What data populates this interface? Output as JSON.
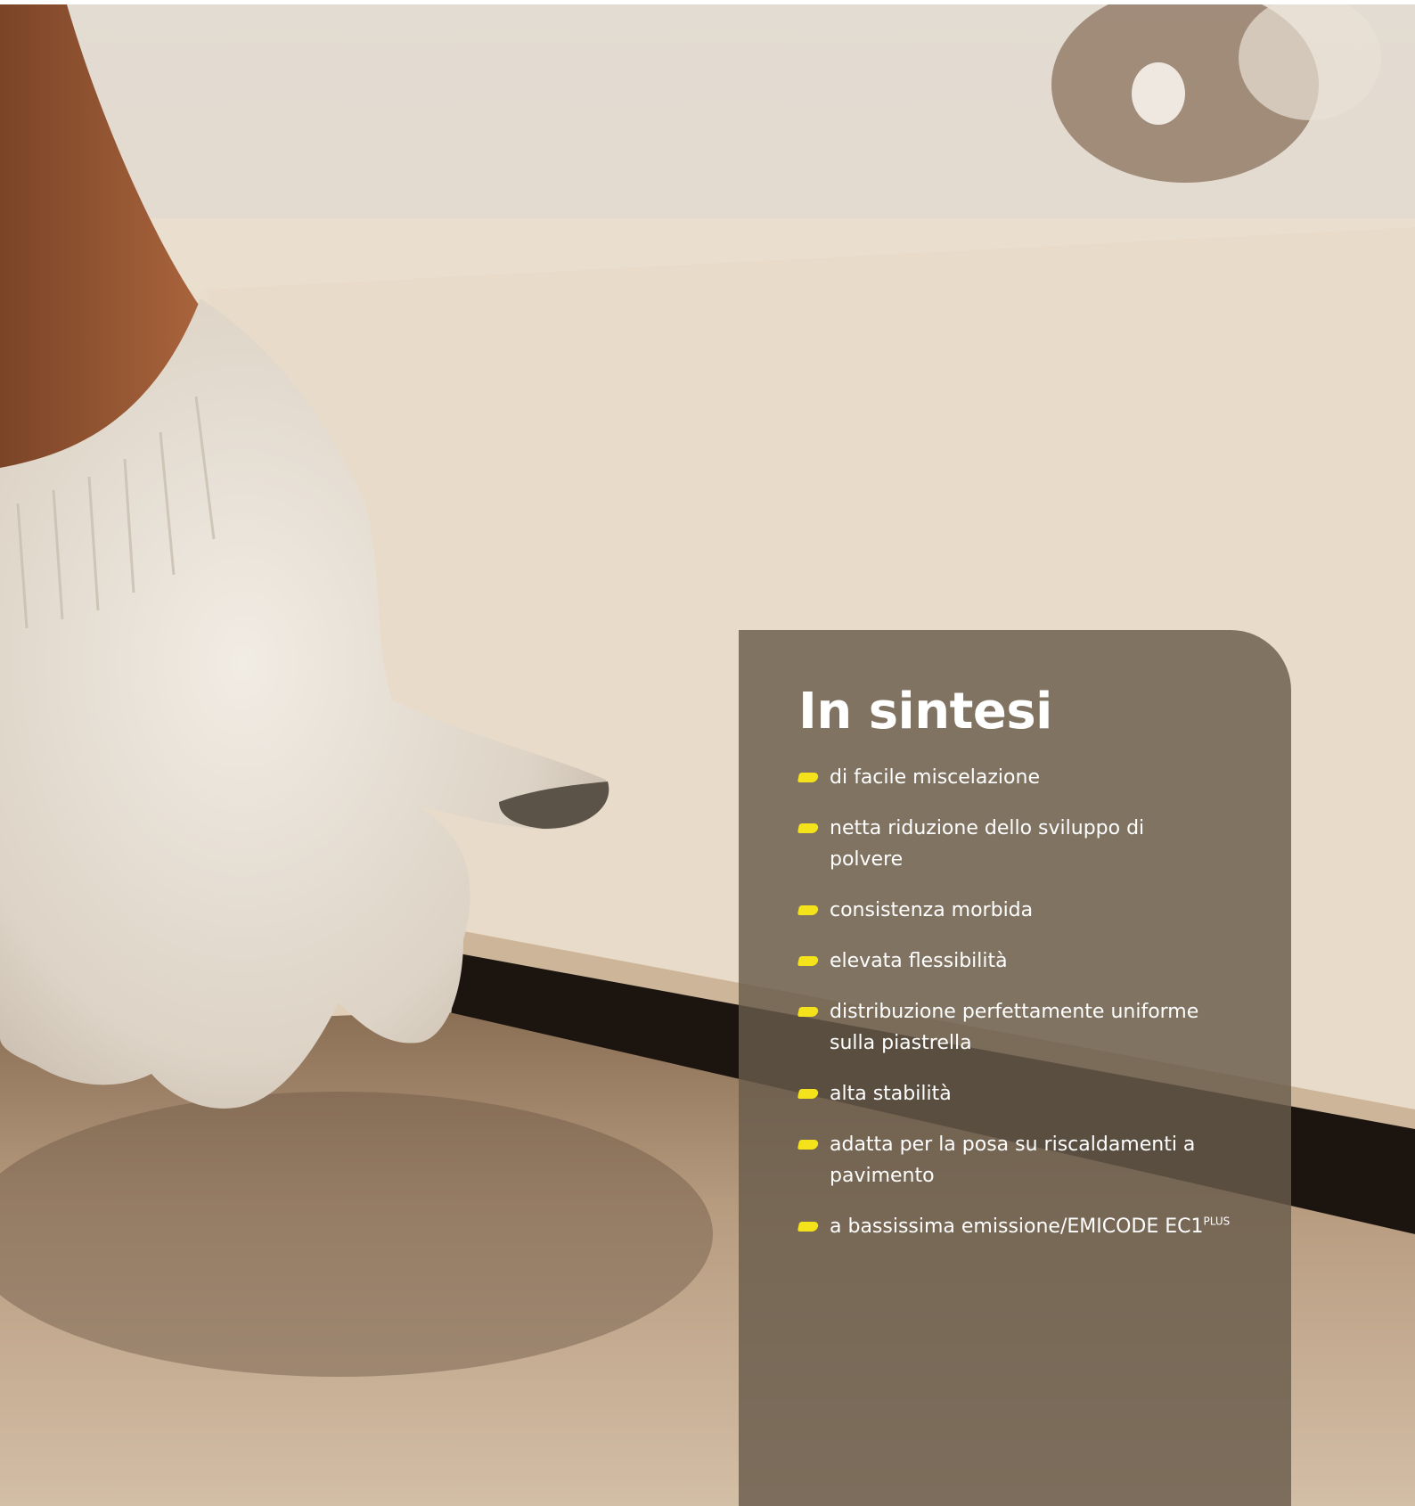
{
  "photo": {
    "subject": "gloved-hand-laying-tile"
  },
  "panel": {
    "title": "In sintesi",
    "bullet_color": "#f4e21a",
    "items": [
      {
        "text": "di facile miscelazione"
      },
      {
        "text": "netta riduzione dello sviluppo di polvere"
      },
      {
        "text": "consistenza morbida"
      },
      {
        "text": "elevata flessibilità"
      },
      {
        "text": "distribuzione perfettamente uniforme sulla piastrella"
      },
      {
        "text": "alta stabilità"
      },
      {
        "text": "adatta per la posa su riscaldamenti a pavimento"
      },
      {
        "text": "a bassissima emissione/EMICODE EC1",
        "sup": "PLUS"
      }
    ]
  }
}
